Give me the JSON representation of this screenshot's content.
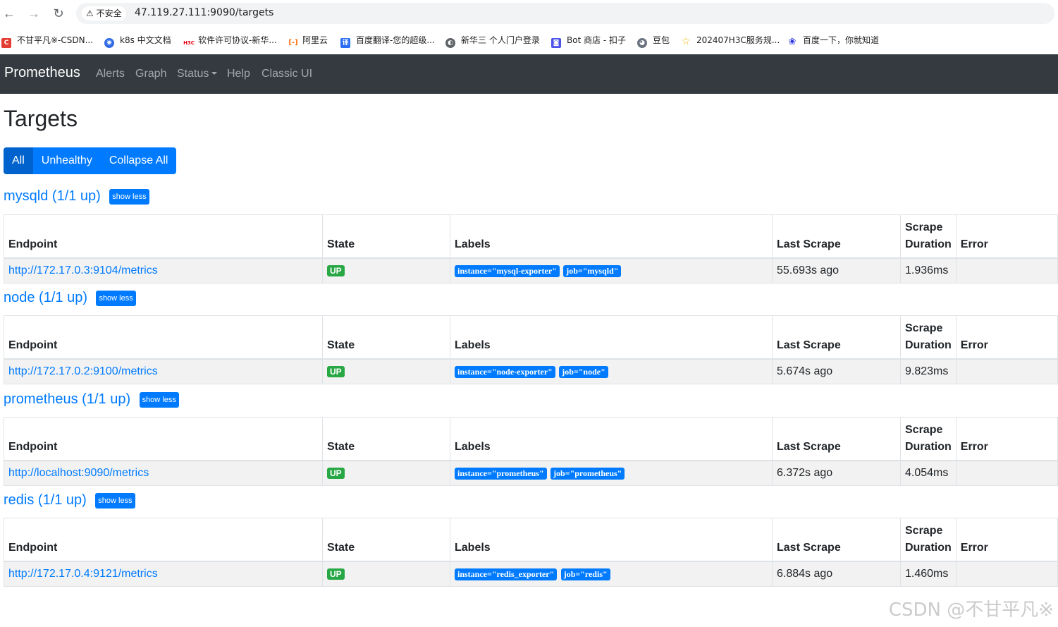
{
  "browser": {
    "security_label": "不安全",
    "url": "47.119.27.111:9090/targets",
    "bookmarks": [
      {
        "label": "不甘平凡※-CSDN...",
        "icon": "csdn-icon",
        "color": "#e33e33",
        "glyph": "C"
      },
      {
        "label": "k8s 中文文档",
        "icon": "k8s-icon",
        "color": "#326ce5",
        "glyph": "⎈"
      },
      {
        "label": "软件许可协议-新华...",
        "icon": "h3c-icon",
        "color": "#e60012",
        "glyph": "H3C"
      },
      {
        "label": "阿里云",
        "icon": "aliyun-icon",
        "color": "#ff6a00",
        "glyph": "[-]"
      },
      {
        "label": "百度翻译-您的超级...",
        "icon": "baidu-translate-icon",
        "color": "#2a6df4",
        "glyph": "译"
      },
      {
        "label": "新华三 个人门户登录",
        "icon": "globe-icon",
        "color": "#5f6368",
        "glyph": "◐"
      },
      {
        "label": "Bot 商店 - 扣子",
        "icon": "coze-icon",
        "color": "#4d53e8",
        "glyph": "◙"
      },
      {
        "label": "豆包",
        "icon": "doubao-icon",
        "color": "#6b7280",
        "glyph": "◕"
      },
      {
        "label": "202407H3C服务规...",
        "icon": "star-icon",
        "color": "#f4b400",
        "glyph": "☆"
      },
      {
        "label": "百度一下，你就知道",
        "icon": "baidu-paw-icon",
        "color": "#2932e1",
        "glyph": "❀"
      }
    ]
  },
  "navbar": {
    "brand": "Prometheus",
    "links": [
      "Alerts",
      "Graph",
      "Status",
      "Help",
      "Classic UI"
    ]
  },
  "page": {
    "title": "Targets",
    "filters": [
      "All",
      "Unhealthy",
      "Collapse All"
    ],
    "active_filter": "All"
  },
  "table_headers": {
    "endpoint": "Endpoint",
    "state": "State",
    "labels": "Labels",
    "last_scrape": "Last Scrape",
    "scrape_duration_1": "Scrape",
    "scrape_duration_2": "Duration",
    "error": "Error"
  },
  "show_less_label": "show less",
  "pools": [
    {
      "title": "mysqld (1/1 up)",
      "endpoint": "http://172.17.0.3:9104/metrics",
      "state": "UP",
      "labels": [
        "instance=\"mysql-exporter\"",
        "job=\"mysqld\""
      ],
      "last_scrape": "55.693s ago",
      "duration": "1.936ms",
      "error": ""
    },
    {
      "title": "node (1/1 up)",
      "endpoint": "http://172.17.0.2:9100/metrics",
      "state": "UP",
      "labels": [
        "instance=\"node-exporter\"",
        "job=\"node\""
      ],
      "last_scrape": "5.674s ago",
      "duration": "9.823ms",
      "error": ""
    },
    {
      "title": "prometheus (1/1 up)",
      "endpoint": "http://localhost:9090/metrics",
      "state": "UP",
      "labels": [
        "instance=\"prometheus\"",
        "job=\"prometheus\""
      ],
      "last_scrape": "6.372s ago",
      "duration": "4.054ms",
      "error": ""
    },
    {
      "title": "redis (1/1 up)",
      "endpoint": "http://172.17.0.4:9121/metrics",
      "state": "UP",
      "labels": [
        "instance=\"redis_exporter\"",
        "job=\"redis\""
      ],
      "last_scrape": "6.884s ago",
      "duration": "1.460ms",
      "error": ""
    }
  ],
  "watermark": "CSDN @不甘平凡※"
}
